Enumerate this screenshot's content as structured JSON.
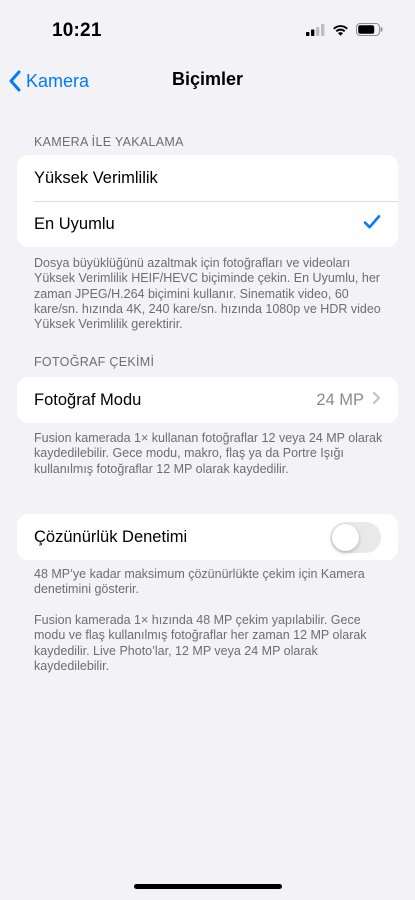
{
  "status_bar": {
    "time": "10:21"
  },
  "nav": {
    "back_label": "Kamera",
    "title": "Biçimler"
  },
  "capture_section": {
    "header": "KAMERA İLE YAKALAMA",
    "options": [
      {
        "label": "Yüksek Verimlilik",
        "selected": false
      },
      {
        "label": "En Uyumlu",
        "selected": true
      }
    ],
    "footer": "Dosya büyüklüğünü azaltmak için fotoğrafları ve videoları Yüksek Verimlilik HEIF/HEVC biçiminde çekin. En Uyumlu, her zaman JPEG/H.264 biçimini kullanır. Sinematik video, 60 kare/sn. hızında 4K, 240 kare/sn. hızında 1080p ve HDR video Yüksek Verimlilik gerektirir."
  },
  "photo_section": {
    "header": "FOTOĞRAF ÇEKİMİ",
    "photo_mode_label": "Fotoğraf Modu",
    "photo_mode_value": "24 MP",
    "footer": "Fusion kamerada 1× kullanan fotoğraflar 12 veya 24 MP olarak kaydedilebilir. Gece modu, makro, flaş ya da Portre Işığı kullanılmış fotoğraflar 12 MP olarak kaydedilir."
  },
  "resolution_section": {
    "label": "Çözünürlük Denetimi",
    "toggle_on": false,
    "footer_1": "48 MP’ye kadar maksimum çözünürlükte çekim için Kamera denetimini gösterir.",
    "footer_2": "Fusion kamerada 1× hızında 48 MP çekim yapılabilir. Gece modu ve flaş kullanılmış fotoğraflar her zaman 12 MP olarak kaydedilir. Live Photo’lar, 12 MP veya 24 MP olarak kaydedilebilir."
  },
  "colors": {
    "accent": "#007aff",
    "background": "#f2f2f7",
    "secondary_text": "#6d6d72"
  },
  "icons": {
    "back": "chevron-left-icon",
    "check": "checkmark-icon",
    "disclosure": "chevron-right-icon",
    "signal": "cellular-signal-icon",
    "wifi": "wifi-icon",
    "battery": "battery-icon"
  }
}
